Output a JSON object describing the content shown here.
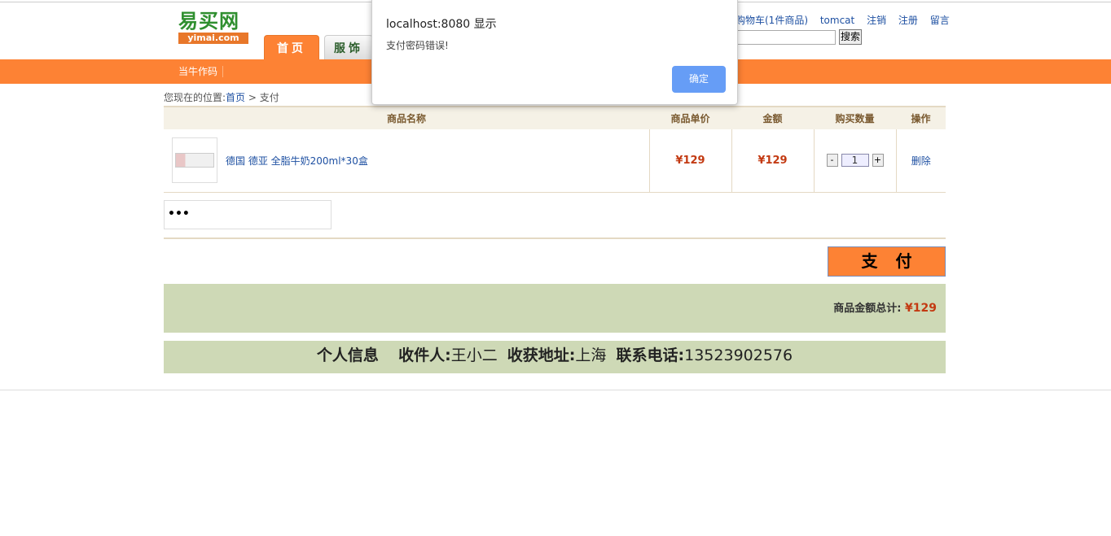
{
  "header": {
    "logo_cn": "易买网",
    "logo_en": "yimai.com",
    "nav_tabs": [
      {
        "label": "首页"
      },
      {
        "label": "服饰"
      }
    ],
    "sub_nav": "当牛作码",
    "top_links": {
      "cart": "购物车(1件商品)",
      "user": "tomcat",
      "logout": "注销",
      "register": "注册",
      "message": "留言"
    },
    "search": {
      "button_label": "搜索",
      "value": ""
    }
  },
  "breadcrumb": {
    "prefix": "您现在的位置:",
    "home": "首页",
    "sep": ">",
    "current": "支付"
  },
  "cart": {
    "headers": [
      "商品名称",
      "商品单价",
      "金额",
      "购买数量",
      "操作"
    ],
    "rows": [
      {
        "name": "德国 德亚 全脂牛奶200ml*30盒",
        "unit_price": "¥129",
        "amount": "¥129",
        "qty": "1",
        "action": "删除",
        "minus": "-",
        "plus": "+"
      }
    ]
  },
  "payment": {
    "password_masked": "•••",
    "pay_label": "支付"
  },
  "total": {
    "label": "商品金额总计:",
    "amount": "¥129"
  },
  "receiver": {
    "section": "个人信息",
    "name_label": "收件人:",
    "name": "王小二",
    "addr_label": "收获地址:",
    "addr": "上海",
    "phone_label": "联系电话:",
    "phone": "13523902576"
  },
  "dialog": {
    "title": "localhost:8080 显示",
    "message": "支付密码错误!",
    "ok_label": "确定"
  },
  "colors": {
    "accent": "#fd8234",
    "price": "#c33a12",
    "panel": "#ced9b6",
    "dialog_button": "#669df6"
  }
}
